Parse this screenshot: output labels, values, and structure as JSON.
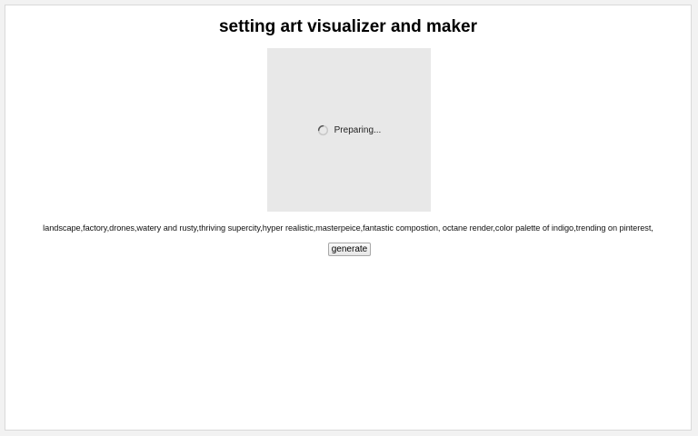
{
  "app": {
    "title": "setting art visualizer and maker"
  },
  "preview": {
    "status_text": "Preparing...",
    "status_icon": "loading-spinner-icon"
  },
  "prompt": {
    "text": "landscape,factory,drones,watery and rusty,thriving supercity,hyper realistic,masterpeice,fantastic compostion, octane render,color palette of indigo,trending on pinterest,"
  },
  "actions": {
    "generate_label": "generate"
  }
}
